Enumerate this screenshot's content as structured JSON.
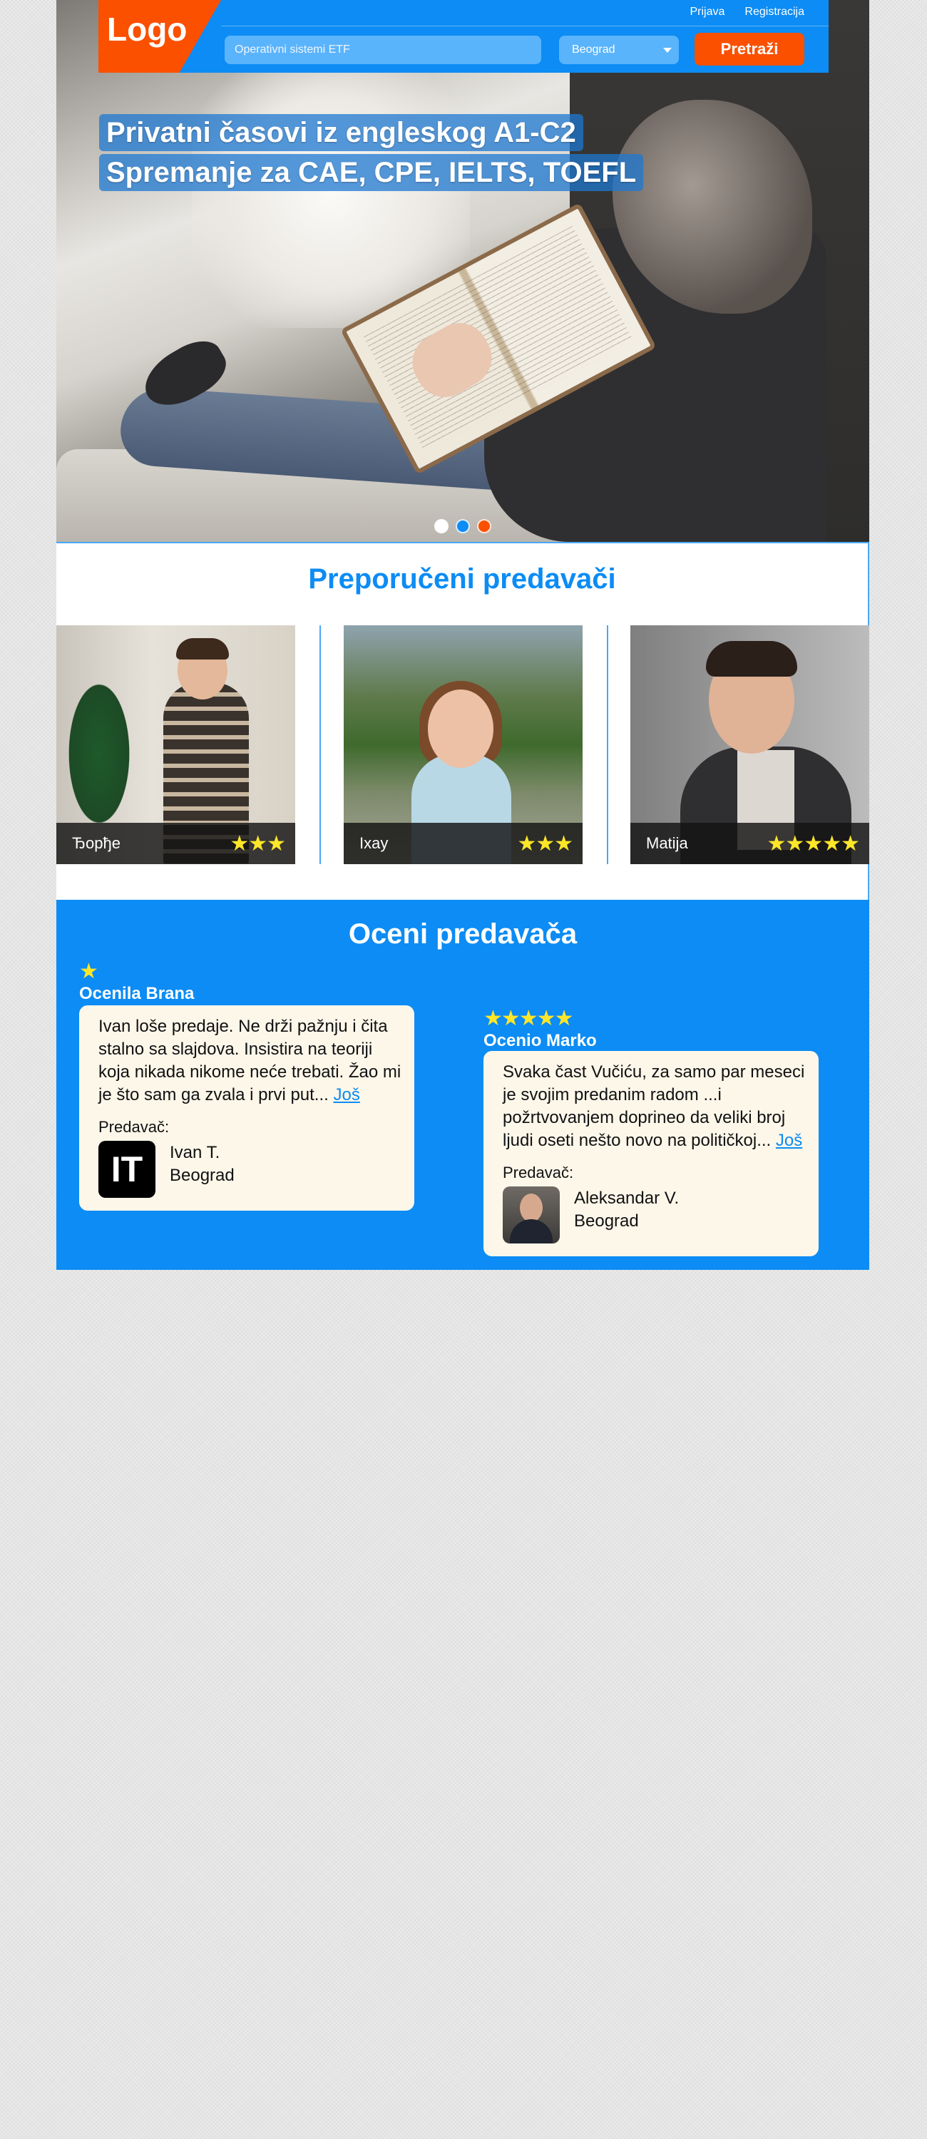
{
  "header": {
    "logo": "Logo",
    "login": "Prijava",
    "register": "Registracija",
    "search_placeholder": "Operativni sistemi ETF",
    "city": "Beograd",
    "search_button": "Pretraži"
  },
  "hero": {
    "line1": "Privatni časovi  iz engleskog A1-C2",
    "line2": "Spremanje za CAE, CPE, IELTS, TOEFL",
    "slides": 3,
    "active_slide": 3,
    "dot_colors": [
      "#ffffff",
      "#0c8cf4",
      "#fb5000"
    ]
  },
  "recommended": {
    "title": "Preporučeni predavači",
    "teachers": [
      {
        "name": "Ђорђе",
        "stars": "★★★",
        "rating": 3
      },
      {
        "name": "Ixay",
        "stars": "★★★",
        "rating": 3
      },
      {
        "name": "Matija",
        "stars": "★★★★★",
        "rating": 5
      }
    ]
  },
  "reviews": {
    "title": "Oceni predavača",
    "items": [
      {
        "stars": "★",
        "rating": 1,
        "author": "Ocenila Brana",
        "text": "Ivan loše predaje. Ne drži pažnju i čita stalno sa slajdova. Insistira na teoriji koja nikada nikome neće trebati. Žao mi je što sam ga zvala i prvi put...",
        "more": "Još",
        "label": "Predavač:",
        "teacher_name": "Ivan T.",
        "teacher_city": "Beograd",
        "avatar_text": "IT"
      },
      {
        "stars": "★★★★★",
        "rating": 5,
        "author": "Ocenio Marko",
        "text": "Svaka čast Vučiću, za samo par meseci je svojim predanim radom ...i požrtvovanjem doprineo da veliki broj ljudi oseti nešto novo na političkoj...",
        "more": "Još",
        "label": "Predavač:",
        "teacher_name": "Aleksandar V.",
        "teacher_city": "Beograd"
      }
    ]
  },
  "colors": {
    "brand_blue": "#0c8cf4",
    "brand_orange": "#fb5000",
    "star_yellow": "#ffe629",
    "review_bg": "#fdf7ea"
  }
}
